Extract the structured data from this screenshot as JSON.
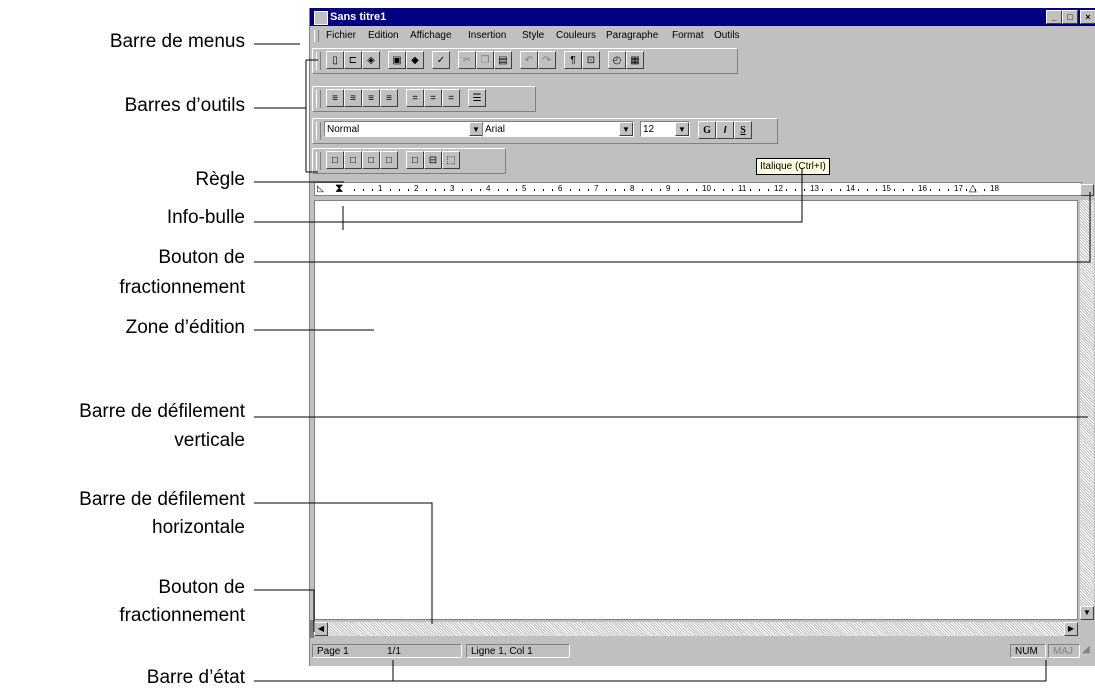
{
  "labels": {
    "menubar": "Barre de menus",
    "toolbars": "Barres d’outils",
    "ruler": "Règle",
    "tooltip": "Info-bulle",
    "split_top_1": "Bouton de",
    "split_top_2": "fractionnement",
    "edit_zone": "Zone d’édition",
    "vscroll_1": "Barre de défilement",
    "vscroll_2": "verticale",
    "hscroll_1": "Barre de défilement",
    "hscroll_2": "horizontale",
    "split_bottom_1": "Bouton de",
    "split_bottom_2": "fractionnement",
    "statusbar": "Barre d’état"
  },
  "window": {
    "title": "Sans titre1",
    "minimize": "_",
    "maximize": "□",
    "close": "×"
  },
  "menu": [
    "Fichier",
    "Edition",
    "Affichage",
    "Insertion",
    "Style",
    "Couleurs",
    "Paragraphe",
    "Format",
    "Outils"
  ],
  "format_bar": {
    "style_value": "Normal",
    "font_value": "Arial",
    "size_value": "12",
    "bold": "G",
    "italic": "I",
    "underline": "S"
  },
  "tooltip_text": "Italique (Ctrl+I)",
  "ruler_numbers": [
    "1",
    "2",
    "3",
    "4",
    "5",
    "6",
    "7",
    "8",
    "9",
    "10",
    "11",
    "12",
    "13",
    "14",
    "15",
    "16",
    "17",
    "18"
  ],
  "status": {
    "page": "Page 1",
    "pages": "1/1",
    "position": "Ligne 1, Col 1",
    "num": "NUM",
    "caps": "MAJ"
  }
}
